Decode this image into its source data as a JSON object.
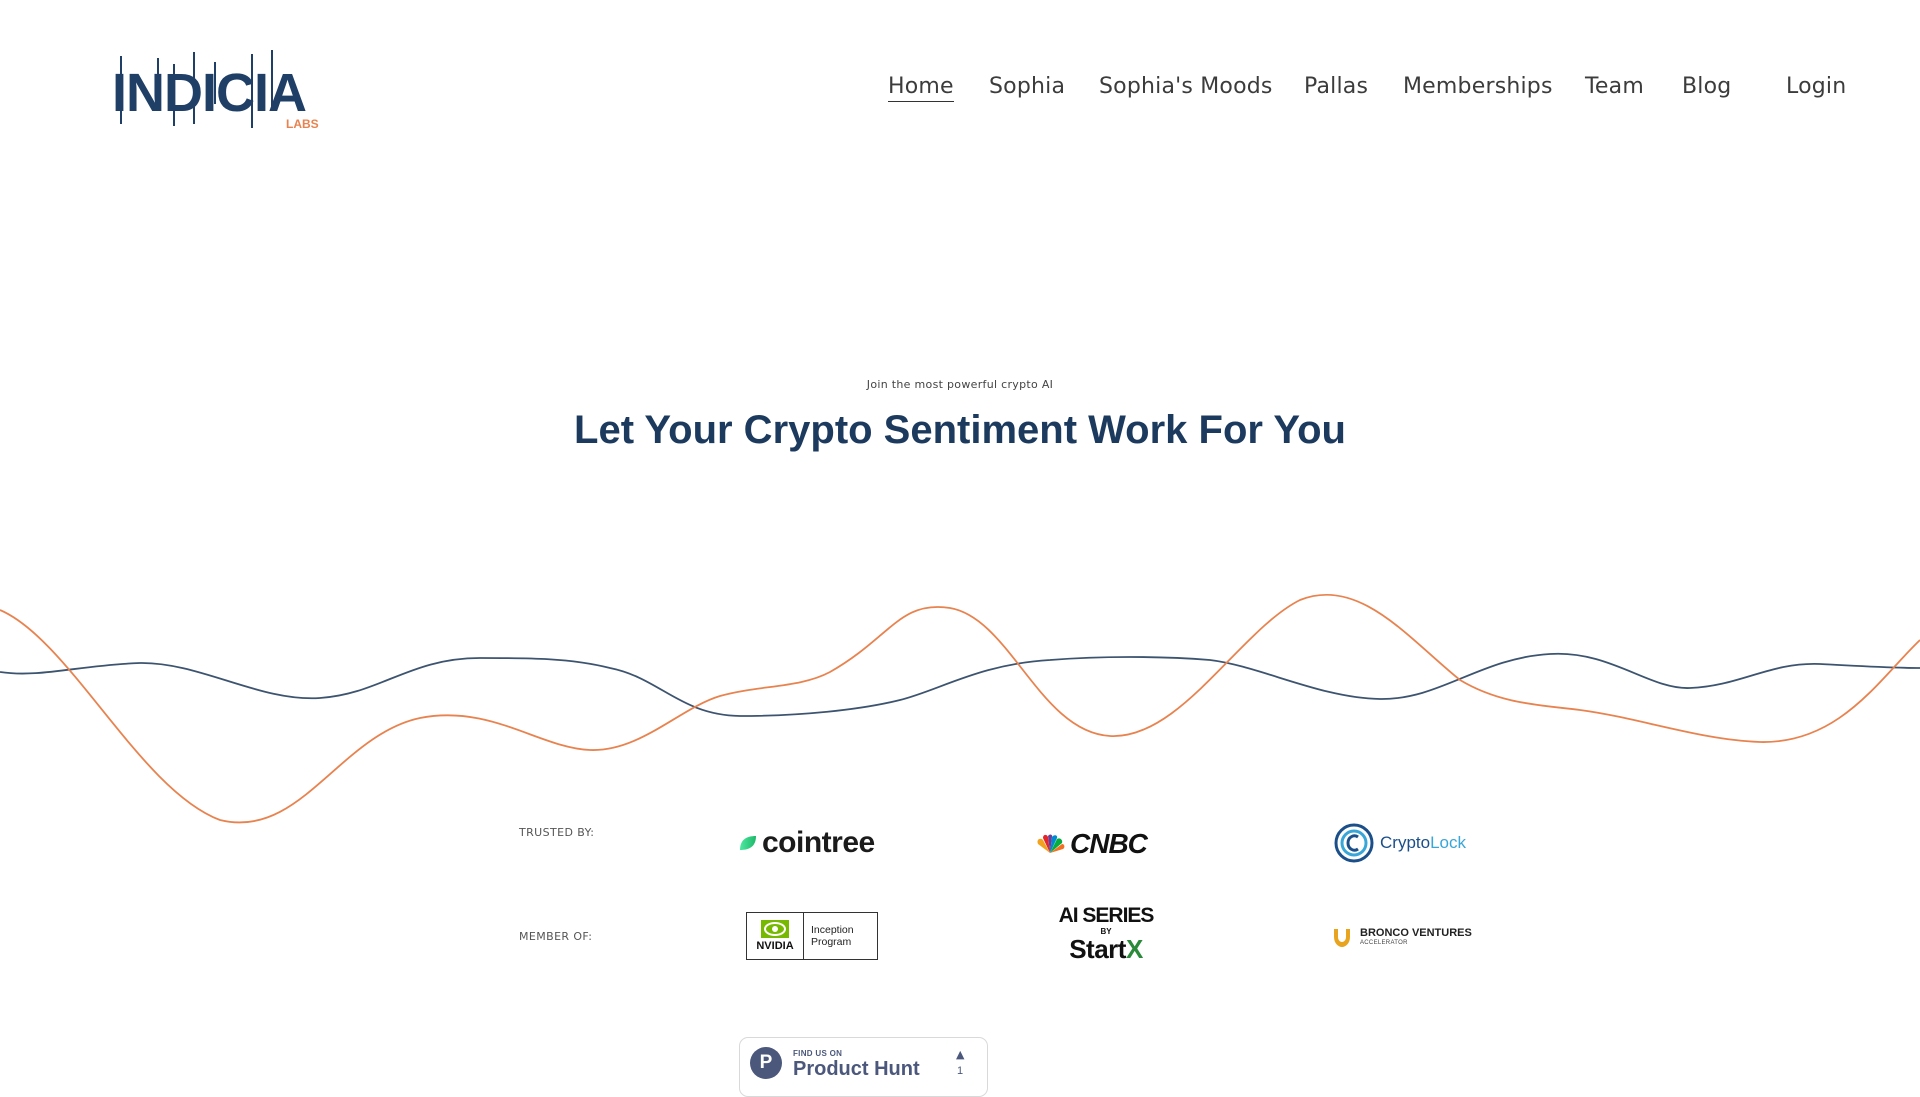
{
  "header": {
    "logo": {
      "primary_text": "INDICIA",
      "secondary_text": "LABS",
      "primary_color": "#1f3f66",
      "accent_color": "#e8834f"
    },
    "nav": [
      {
        "label": "Home",
        "active": true
      },
      {
        "label": "Sophia",
        "active": false
      },
      {
        "label": "Sophia's Moods",
        "active": false
      },
      {
        "label": "Pallas",
        "active": false
      },
      {
        "label": "Memberships",
        "active": false
      },
      {
        "label": "Team",
        "active": false
      },
      {
        "label": "Blog",
        "active": false
      }
    ],
    "login_label": "Login"
  },
  "hero": {
    "eyebrow": "Join the most powerful crypto AI",
    "headline": "Let Your Crypto Sentiment Work For You",
    "wave_colors": {
      "navy": "#3d5470",
      "orange": "#e8834f"
    }
  },
  "trusted": {
    "label": "TRUSTED BY:",
    "logos": [
      {
        "name": "cointree",
        "icon": "leaf-icon"
      },
      {
        "name": "CNBC",
        "icon": "peacock-icon"
      },
      {
        "name_a": "Crypto",
        "name_b": "Lock",
        "icon": "crypto-lock-icon"
      }
    ]
  },
  "member": {
    "label": "MEMBER OF:",
    "logos": [
      {
        "brand": "NVIDIA",
        "line1": "Inception",
        "line2": "Program",
        "icon": "nvidia-eye-icon"
      },
      {
        "line1": "AI SERIES",
        "line2": "BY",
        "line3": "Start",
        "line3_accent": "X"
      },
      {
        "line1": "BRONCO VENTURES",
        "line2": "ACCELERATOR",
        "icon": "horseshoe-icon"
      }
    ]
  },
  "product_hunt": {
    "find_label": "FIND US ON",
    "name": "Product Hunt",
    "letter": "P",
    "upvotes": "1"
  }
}
